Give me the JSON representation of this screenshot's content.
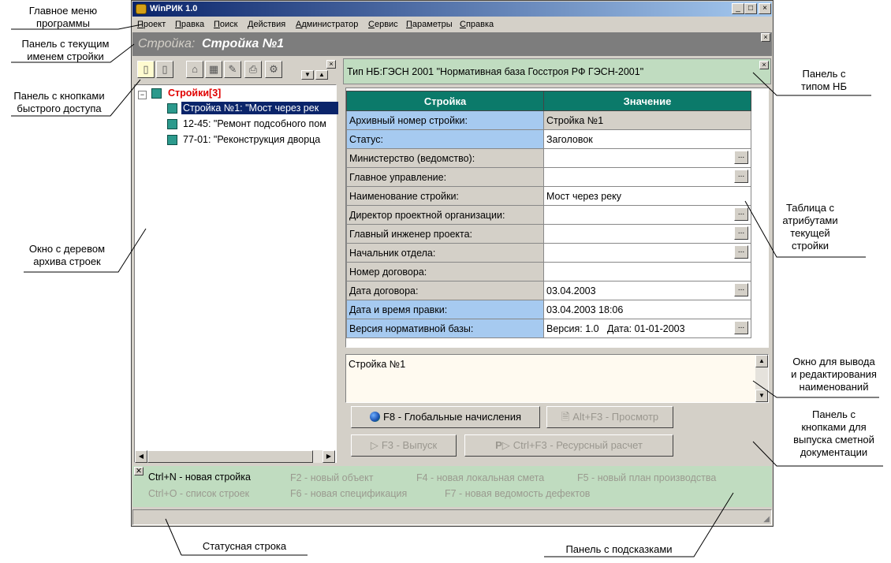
{
  "window": {
    "title": "WinPИК 1.0"
  },
  "menu": [
    "Проект",
    "Правка",
    "Поиск",
    "Действия",
    "Администратор",
    "Сервис",
    "Параметры",
    "Справка"
  ],
  "stroyka_bar": {
    "label": "Стройка:",
    "value": "Стройка №1"
  },
  "toolbar": {
    "icons": [
      "new-doc-icon",
      "copy-doc-icon",
      "home-icon",
      "table-icon",
      "edit-icon",
      "print-icon",
      "settings-icon",
      "down-arrow-icon",
      "up-arrow-icon"
    ]
  },
  "tree": {
    "root": "Стройки[3]",
    "items": [
      "Стройка №1: \"Мост через рек",
      "12-45: \"Ремонт подсобного пом",
      "77-01: \"Реконструкция дворца"
    ]
  },
  "nb_panel": {
    "text": "Тип НБ:ГЭСН 2001 \"Нормативная база Госстроя РФ ГЭСН-2001\""
  },
  "grid": {
    "headers": [
      "Стройка",
      "Значение"
    ],
    "rows": [
      {
        "key": "Архивный номер стройки:",
        "value": "Стройка №1"
      },
      {
        "key": "Статус:",
        "value": "Заголовок"
      },
      {
        "key": "Министерство (ведомство):",
        "value": ""
      },
      {
        "key": "Главное управление:",
        "value": ""
      },
      {
        "key": "Наименование стройки:",
        "value": "Мост через реку"
      },
      {
        "key": "Директор проектной организации:",
        "value": ""
      },
      {
        "key": "Главный инженер проекта:",
        "value": ""
      },
      {
        "key": "Начальник отдела:",
        "value": ""
      },
      {
        "key": "Номер договора:",
        "value": ""
      },
      {
        "key": "Дата договора:",
        "value": "03.04.2003"
      },
      {
        "key": "Дата и время правки:",
        "value": "03.04.2003  18:06"
      },
      {
        "key": "Версия нормативной базы:",
        "value": "Версия: 1.0   Дата: 01-01-2003"
      }
    ],
    "dots_label": "..."
  },
  "name_box": {
    "text": "Стройка №1"
  },
  "buttons": {
    "global": "F8 - Глобальные начисления",
    "preview": "Alt+F3 - Просмотр",
    "release": "F3 - Выпуск",
    "resource": "Ctrl+F3 - Ресурсный расчет"
  },
  "hints": {
    "h1": "Ctrl+N - новая стройка",
    "h2": "F2 - новый объект",
    "h3": "F4 - новая локальная смета",
    "h4": "F5 - новый план производства",
    "h5": "Ctrl+O - список строек",
    "h6": "F6 - новая спецификация",
    "h7": "F7 - новая ведомость дефектов"
  },
  "annotations": {
    "a1": "Главное меню\nпрограммы",
    "a2": "Панель с текущим\nименем стройки",
    "a3": "Панель с кнопками\nбыстрого доступа",
    "a4": "Окно с деревом\nархива строек",
    "a5": "Панель с\nтипом НБ",
    "a6": "Таблица с\nатрибутами\nтекущей\nстройки",
    "a7": "Окно для вывода\nи редактирования\nнаименований",
    "a8": "Панель с\nкнопками для\nвыпуска сметной\nдокументации",
    "a9": "Статусная строка",
    "a10": "Панель с подсказками"
  }
}
